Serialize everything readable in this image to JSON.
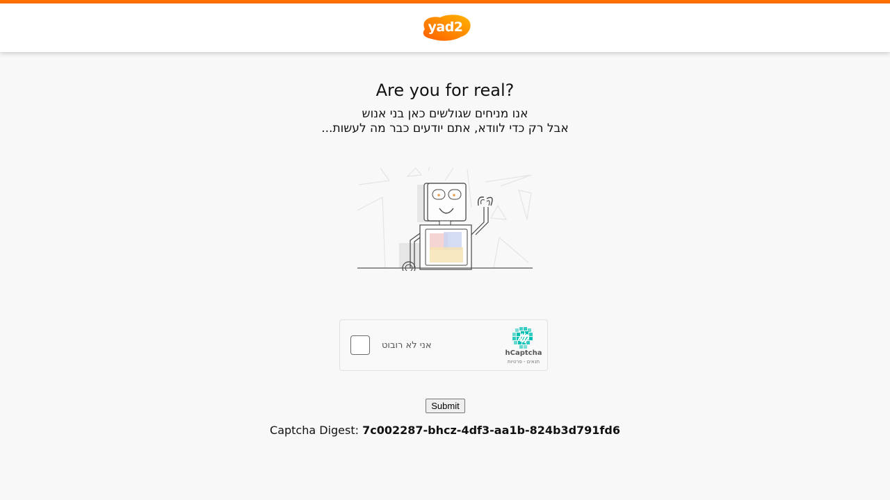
{
  "brand": {
    "logo_text": "yad2",
    "accent_color": "#ff7100",
    "logo_gradient": [
      "#ff5e00",
      "#ffb400"
    ]
  },
  "main": {
    "title": "Are you for real?",
    "subtitle_line1": "אנו מניחים שגולשים כאן בני אנוש",
    "subtitle_line2": "אבל רק כדי לוודא, אתם יודעים כבר מה לעשות...",
    "illustration_icon": "robot-waving-icon"
  },
  "captcha": {
    "checkbox_label": "אני לא רובוט",
    "provider_name": "hCaptcha",
    "provider_links": "תנאים - פרטיות",
    "checked": false,
    "brand_color": "#00bfb3"
  },
  "form": {
    "submit_label": "Submit"
  },
  "digest": {
    "label": "Captcha Digest:",
    "value": "7c002287-bhcz-4df3-aa1b-824b3d791fd6"
  }
}
